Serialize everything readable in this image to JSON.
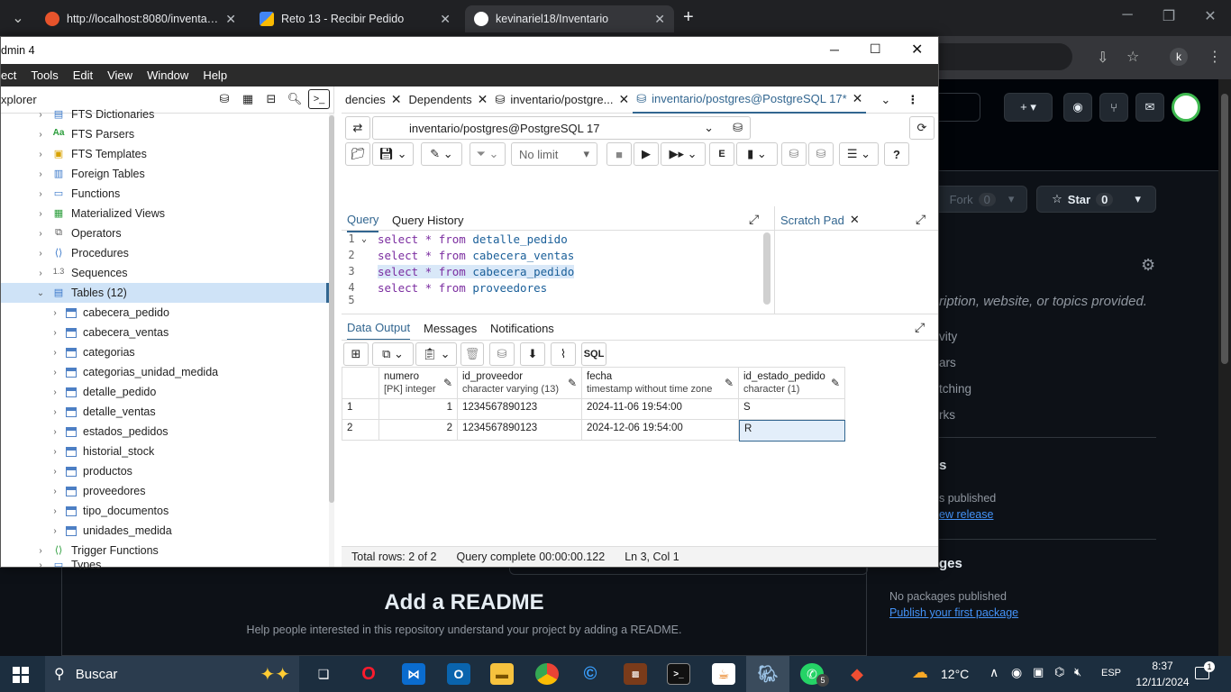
{
  "browser": {
    "tabs": [
      {
        "title": "http://localhost:8080/inventarios",
        "favicon_color": "#e8542c"
      },
      {
        "title": "Reto 13 - Recibir Pedido",
        "favicon_color": "#4285f4"
      },
      {
        "title": "kevinariel18/Inventario",
        "favicon_color": "#ffffff"
      }
    ],
    "new_tab": "+",
    "avatar_letter": "k"
  },
  "github": {
    "fork_label": "Fork",
    "fork_count": "0",
    "star_label": "Star",
    "star_count": "0",
    "about_fragment": "ription, website, or topics provided.",
    "side_items": [
      "vity",
      "ars",
      "tching",
      "rks"
    ],
    "releases_heading": "s",
    "releases_text": "s published",
    "releases_link": "ew release",
    "packages_heading": "ges",
    "packages_text": "No packages published",
    "packages_link": "Publish your first package",
    "readme_title": "Add a README",
    "readme_sub": "Help people interested in this repository understand your project by adding a README."
  },
  "pgadmin": {
    "title": "dmin 4",
    "menu": [
      "ect",
      "Tools",
      "Edit",
      "View",
      "Window",
      "Help"
    ],
    "explorer_label": "xplorer",
    "tree": [
      {
        "label": "FTS Dictionaries",
        "icon": "dict-icon",
        "level": 1
      },
      {
        "label": "FTS Parsers",
        "icon": "parser-icon",
        "level": 1
      },
      {
        "label": "FTS Templates",
        "icon": "template-icon",
        "level": 1
      },
      {
        "label": "Foreign Tables",
        "icon": "foreign-table-icon",
        "level": 1
      },
      {
        "label": "Functions",
        "icon": "function-icon",
        "level": 1
      },
      {
        "label": "Materialized Views",
        "icon": "matview-icon",
        "level": 1
      },
      {
        "label": "Operators",
        "icon": "operator-icon",
        "level": 1
      },
      {
        "label": "Procedures",
        "icon": "procedure-icon",
        "level": 1
      },
      {
        "label": "Sequences",
        "icon": "sequence-icon",
        "level": 1
      },
      {
        "label": "Tables (12)",
        "icon": "tables-icon",
        "level": 1,
        "expanded": true,
        "selected": true
      },
      {
        "label": "cabecera_pedido",
        "icon": "table-icon",
        "level": 2
      },
      {
        "label": "cabecera_ventas",
        "icon": "table-icon",
        "level": 2
      },
      {
        "label": "categorias",
        "icon": "table-icon",
        "level": 2
      },
      {
        "label": "categorias_unidad_medida",
        "icon": "table-icon",
        "level": 2
      },
      {
        "label": "detalle_pedido",
        "icon": "table-icon",
        "level": 2
      },
      {
        "label": "detalle_ventas",
        "icon": "table-icon",
        "level": 2
      },
      {
        "label": "estados_pedidos",
        "icon": "table-icon",
        "level": 2
      },
      {
        "label": "historial_stock",
        "icon": "table-icon",
        "level": 2
      },
      {
        "label": "productos",
        "icon": "table-icon",
        "level": 2
      },
      {
        "label": "proveedores",
        "icon": "table-icon",
        "level": 2
      },
      {
        "label": "tipo_documentos",
        "icon": "table-icon",
        "level": 2
      },
      {
        "label": "unidades_medida",
        "icon": "table-icon",
        "level": 2
      },
      {
        "label": "Trigger Functions",
        "icon": "trigger-icon",
        "level": 1
      },
      {
        "label": "Types",
        "icon": "type-icon",
        "level": 1
      }
    ],
    "query_tabs": [
      {
        "label": "dencies"
      },
      {
        "label": "Dependents"
      },
      {
        "label": "inventario/postgre..."
      },
      {
        "label": "inventario/postgres@PostgreSQL 17*",
        "active": true
      }
    ],
    "connection": "inventario/postgres@PostgreSQL 17",
    "limit": "No limit",
    "subtabs": {
      "query": "Query",
      "history": "Query History",
      "scratch": "Scratch Pad"
    },
    "code": [
      {
        "n": "1",
        "text": "select * from detalle_pedido",
        "kw": "select * from",
        "tbl": "detalle_pedido"
      },
      {
        "n": "2",
        "text": "select * from cabecera_ventas",
        "kw": "select * from",
        "tbl": "cabecera_ventas"
      },
      {
        "n": "3",
        "text": "select * from cabecera_pedido",
        "kw": "select * from",
        "tbl": "cabecera_pedido",
        "highlight": true
      },
      {
        "n": "4",
        "text": "select * from proveedores",
        "kw": "select * from",
        "tbl": "proveedores"
      },
      {
        "n": "5",
        "text": "",
        "kw": "",
        "tbl": ""
      }
    ],
    "output_tabs": [
      "Data Output",
      "Messages",
      "Notifications"
    ],
    "sql_label": "SQL",
    "grid": {
      "columns": [
        {
          "name": "numero",
          "type": "[PK] integer"
        },
        {
          "name": "id_proveedor",
          "type": "character varying (13)"
        },
        {
          "name": "fecha",
          "type": "timestamp without time zone"
        },
        {
          "name": "id_estado_pedido",
          "type": "character (1)"
        }
      ],
      "rows": [
        {
          "idx": "1",
          "cells": [
            "1",
            "1234567890123",
            "2024-11-06 19:54:00",
            "S"
          ]
        },
        {
          "idx": "2",
          "cells": [
            "2",
            "1234567890123",
            "2024-12-06 19:54:00",
            "R"
          ]
        }
      ]
    },
    "status": {
      "rows": "Total rows: 2 of 2",
      "query": "Query complete 00:00:00.122",
      "pos": "Ln 3, Col 1"
    }
  },
  "taskbar": {
    "search": "Buscar",
    "weather": "12°C",
    "lang": "ESP",
    "time": "8:37",
    "date": "12/11/2024",
    "notif_count": "1",
    "whatsapp_badge": "5"
  }
}
